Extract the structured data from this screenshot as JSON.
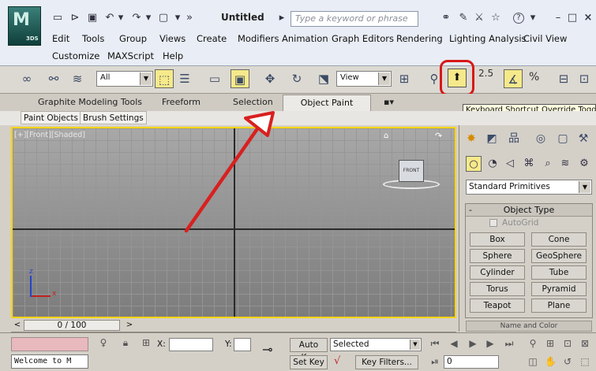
{
  "app": {
    "logo_text": "M",
    "logo_sub": "3DS",
    "doc_title": "Untitled"
  },
  "quick_access": {
    "overflow": "»"
  },
  "search": {
    "placeholder": "Type a keyword or phrase"
  },
  "window_controls": {
    "help": "?",
    "minimize": "–",
    "maximize": "□",
    "close": "×"
  },
  "menu": {
    "row1": [
      "Edit",
      "Tools",
      "Group",
      "Views",
      "Create",
      "Modifiers",
      "Animation",
      "Graph Editors",
      "Rendering",
      "Lighting Analysis",
      "Civil View"
    ],
    "row2": [
      "Customize",
      "MAXScript",
      "Help"
    ]
  },
  "toolbar": {
    "selection_filter": "All",
    "ref_coord": "View",
    "snap_angle": "2.5",
    "percent": "%"
  },
  "ribbon": {
    "tabs": [
      "Graphite Modeling Tools",
      "Freeform",
      "Selection",
      "Object Paint"
    ],
    "active_tab": "Object Paint",
    "options": "▪▾",
    "subtabs": [
      "Paint Objects",
      "Brush Settings"
    ]
  },
  "tooltip": "Keyboard Shortcut Override Toggle",
  "viewport": {
    "label": "[+][Front][Shaded]",
    "viewcube_face": "FRONT",
    "axis_x": "x",
    "axis_z": "z"
  },
  "command_panel": {
    "category": "Standard Primitives",
    "rollout_object_type": "Object Type",
    "rollout_minus": "-",
    "autogrid": "AutoGrid",
    "buttons": [
      "Box",
      "Cone",
      "Sphere",
      "GeoSphere",
      "Cylinder",
      "Tube",
      "Torus",
      "Pyramid",
      "Teapot",
      "Plane"
    ],
    "rollout_name_color": "Name and Color"
  },
  "time_slider": {
    "position": "0 / 100",
    "prev": "<",
    "next": ">"
  },
  "status": {
    "listener": "Welcome to M",
    "prompt": "Keyboard Shortcut Override Toggle",
    "x_label": "X:",
    "y_label": "Y:",
    "auto_key": "Auto Key",
    "set_key": "Set Key",
    "key_mode": "Selected",
    "key_filters": "Key Filters...",
    "frame": "0"
  },
  "colors": {
    "highlight_ring": "#d81818",
    "viewport_border": "#ffd400",
    "annotation_arrow": "#d82020",
    "tooltip_bg": "#ffffe1",
    "active_button": "#f6e98a"
  }
}
